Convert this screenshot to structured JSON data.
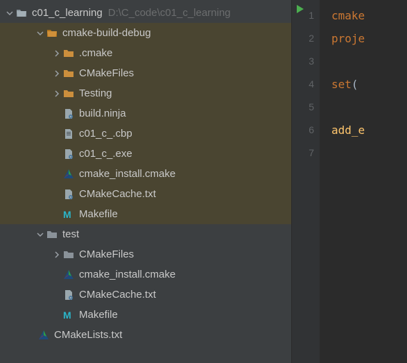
{
  "sidebar": {
    "project": {
      "name": "c01_c_learning",
      "path": "D:\\C_code\\c01_c_learning"
    },
    "items": [
      {
        "label": "cmake-build-debug",
        "type": "folder-open",
        "hl": true,
        "indent": 1,
        "chev": "down"
      },
      {
        "label": ".cmake",
        "type": "folder",
        "hl": true,
        "indent": 2,
        "chev": "right"
      },
      {
        "label": "CMakeFiles",
        "type": "folder",
        "hl": true,
        "indent": 2,
        "chev": "right"
      },
      {
        "label": "Testing",
        "type": "folder",
        "hl": true,
        "indent": 2,
        "chev": "right"
      },
      {
        "label": "build.ninja",
        "type": "gear-file",
        "hl": true,
        "indent": 2,
        "chev": ""
      },
      {
        "label": "c01_c_.cbp",
        "type": "text-file",
        "hl": true,
        "indent": 2,
        "chev": ""
      },
      {
        "label": "c01_c_.exe",
        "type": "gear-file",
        "hl": true,
        "indent": 2,
        "chev": ""
      },
      {
        "label": "cmake_install.cmake",
        "type": "cmake",
        "hl": true,
        "indent": 2,
        "chev": ""
      },
      {
        "label": "CMakeCache.txt",
        "type": "gear-file",
        "hl": true,
        "indent": 2,
        "chev": ""
      },
      {
        "label": "Makefile",
        "type": "makefile",
        "hl": true,
        "indent": 2,
        "chev": ""
      },
      {
        "label": "test",
        "type": "folder-grey",
        "hl": false,
        "indent": 1,
        "chev": "down"
      },
      {
        "label": "CMakeFiles",
        "type": "folder-grey",
        "hl": false,
        "indent": 2,
        "chev": "right"
      },
      {
        "label": "cmake_install.cmake",
        "type": "cmake",
        "hl": false,
        "indent": 2,
        "chev": ""
      },
      {
        "label": "CMakeCache.txt",
        "type": "gear-file",
        "hl": false,
        "indent": 2,
        "chev": ""
      },
      {
        "label": "Makefile",
        "type": "makefile",
        "hl": false,
        "indent": 2,
        "chev": ""
      },
      {
        "label": "CMakeLists.txt",
        "type": "cmake",
        "hl": false,
        "indent": 0.5,
        "chev": ""
      }
    ]
  },
  "gutter": {
    "lines": [
      "1",
      "2",
      "3",
      "4",
      "5",
      "6",
      "7"
    ]
  },
  "editor": {
    "lines": [
      {
        "kw": "cmake",
        "rest": ""
      },
      {
        "kw": "proje",
        "rest": ""
      },
      {
        "kw": "",
        "rest": ""
      },
      {
        "kw": "set",
        "rest": "("
      },
      {
        "kw": "",
        "rest": ""
      },
      {
        "kw": "add_e",
        "rest": ""
      },
      {
        "kw": "",
        "rest": ""
      }
    ]
  }
}
